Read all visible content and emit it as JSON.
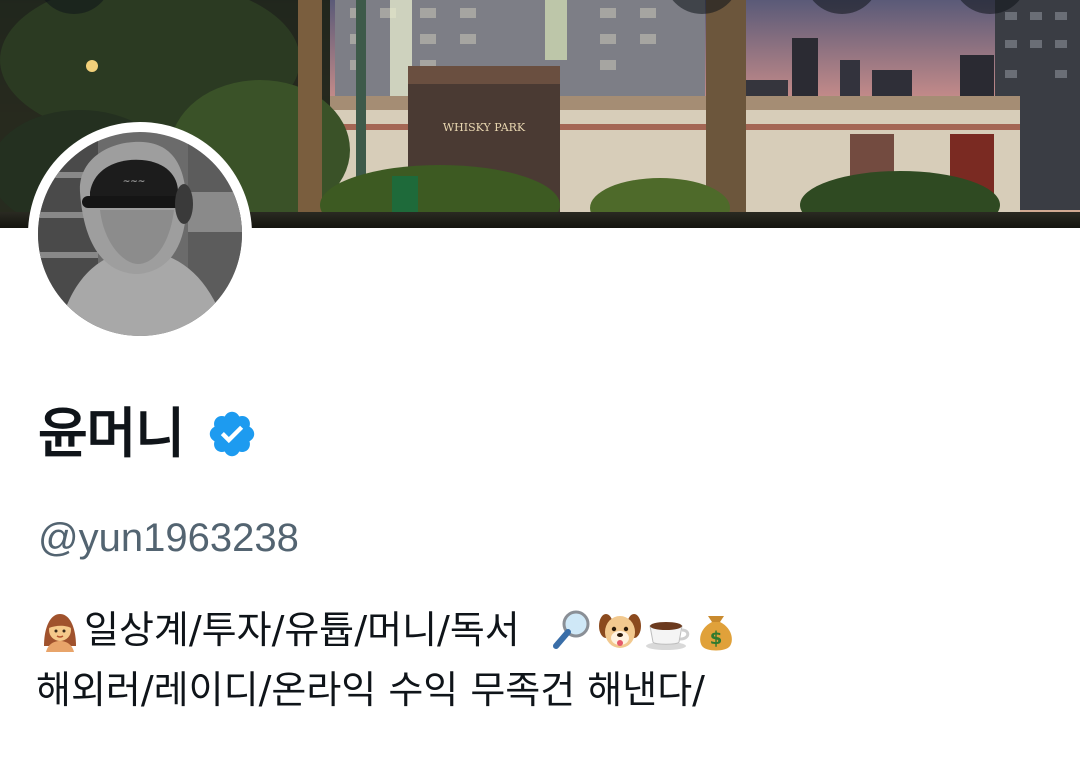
{
  "header": {
    "back_icon": "arrow-left-icon",
    "search_icon": "search-icon",
    "share_icon": "share-icon",
    "more_icon": "more-icon"
  },
  "banner": {
    "sign_text": "WHISKY PARK"
  },
  "profile": {
    "display_name": "윤머니",
    "verified_icon": "verified-badge-icon",
    "verified_color": "#1d9bf0",
    "handle": "@yun1963238",
    "bio": {
      "line1_icon": "person-icon",
      "line1_text": "일상계/투자/유튭/머니/독서",
      "line1_icons": [
        "magnifier-icon",
        "dog-face-icon",
        "coffee-icon",
        "money-bag-icon"
      ],
      "line2_text": "해외러/레이디/온라익 수익 무족건 해낸다/"
    }
  },
  "colors": {
    "text_primary": "#0f1419",
    "text_secondary": "#536471",
    "accent": "#1d9bf0",
    "background": "#ffffff"
  }
}
